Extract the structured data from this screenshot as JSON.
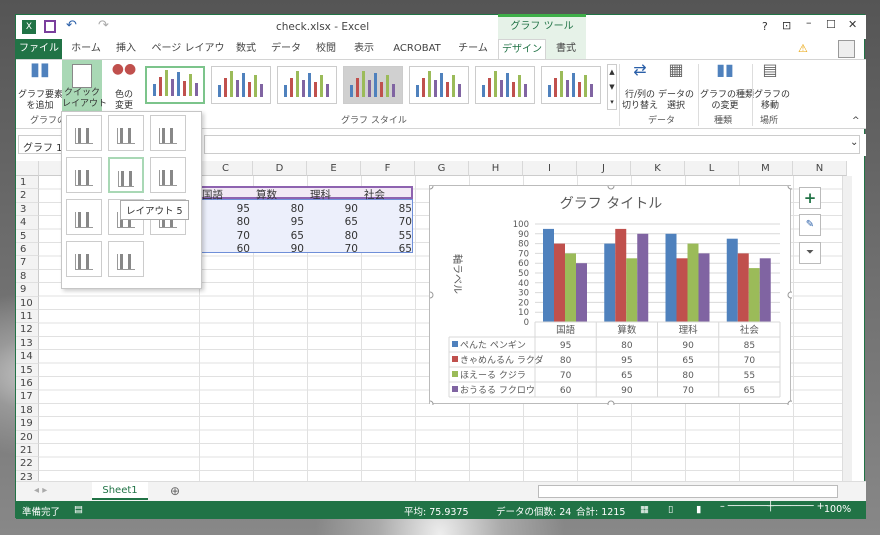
{
  "window": {
    "title": "check.xlsx - Excel",
    "context_tab_group": "グラフ ツール",
    "help": "?",
    "minimize": "_"
  },
  "tabs": [
    "ファイル",
    "ホーム",
    "挿入",
    "ページ レイアウト",
    "数式",
    "データ",
    "校閲",
    "表示",
    "ACROBAT",
    "チーム",
    "デザイン",
    "書式"
  ],
  "ribbon": {
    "add_element": "グラフ要素\nを追加",
    "quick_layout": "クイック\nレイアウト",
    "change_colors": "色の\n変更",
    "switch_row_col": "行/列の\n切り替え",
    "select_data": "データの\n選択",
    "change_type": "グラフの種類\nの変更",
    "move_chart": "グラフの\n移動",
    "groups": {
      "layouts": "グラフのレ",
      "styles": "グラフ スタイル",
      "data": "データ",
      "type": "種類",
      "location": "場所"
    }
  },
  "name_box": "グラフ 1",
  "layout_tooltip": "レイアウト 5",
  "columns": [
    "C",
    "D",
    "E",
    "F",
    "G",
    "H",
    "I",
    "J",
    "K",
    "L",
    "M",
    "N"
  ],
  "rows": [
    "1",
    "2",
    "3",
    "4",
    "5",
    "6",
    "7",
    "8",
    "9",
    "10",
    "11",
    "12",
    "13",
    "14",
    "15",
    "16",
    "17",
    "18",
    "19",
    "20",
    "21",
    "22",
    "23"
  ],
  "table": {
    "headers": [
      "国語",
      "算数",
      "理科",
      "社会"
    ],
    "rows": [
      [
        "95",
        "80",
        "90",
        "85"
      ],
      [
        "80",
        "95",
        "65",
        "70"
      ],
      [
        "70",
        "65",
        "80",
        "55"
      ],
      [
        "60",
        "90",
        "70",
        "65"
      ]
    ]
  },
  "chart_data": {
    "type": "bar",
    "title": "グラフ タイトル",
    "ylabel": "軸ラベル",
    "ylim": [
      0,
      100
    ],
    "yticks": [
      "0",
      "10",
      "20",
      "30",
      "40",
      "50",
      "60",
      "70",
      "80",
      "90",
      "100"
    ],
    "categories": [
      "国語",
      "算数",
      "理科",
      "社会"
    ],
    "series": [
      {
        "name": "ぺんた ペンギン",
        "values": [
          95,
          80,
          90,
          85
        ],
        "color": "#4f81bd"
      },
      {
        "name": "きゃめんるん ラクダ",
        "values": [
          80,
          95,
          65,
          70
        ],
        "color": "#c0504d"
      },
      {
        "name": "ほえーる クジラ",
        "values": [
          70,
          65,
          80,
          55
        ],
        "color": "#9bbb59"
      },
      {
        "name": "おうるる フクロウ",
        "values": [
          60,
          90,
          70,
          65
        ],
        "color": "#8064a2"
      }
    ],
    "legend": "data-table"
  },
  "sheet_tab": "Sheet1",
  "status": {
    "ready": "準備完了",
    "average": "平均: 75.9375",
    "count": "データの個数: 24",
    "sum": "合計: 1215",
    "zoom": "100%"
  },
  "colors": {
    "accent": "#217346"
  }
}
